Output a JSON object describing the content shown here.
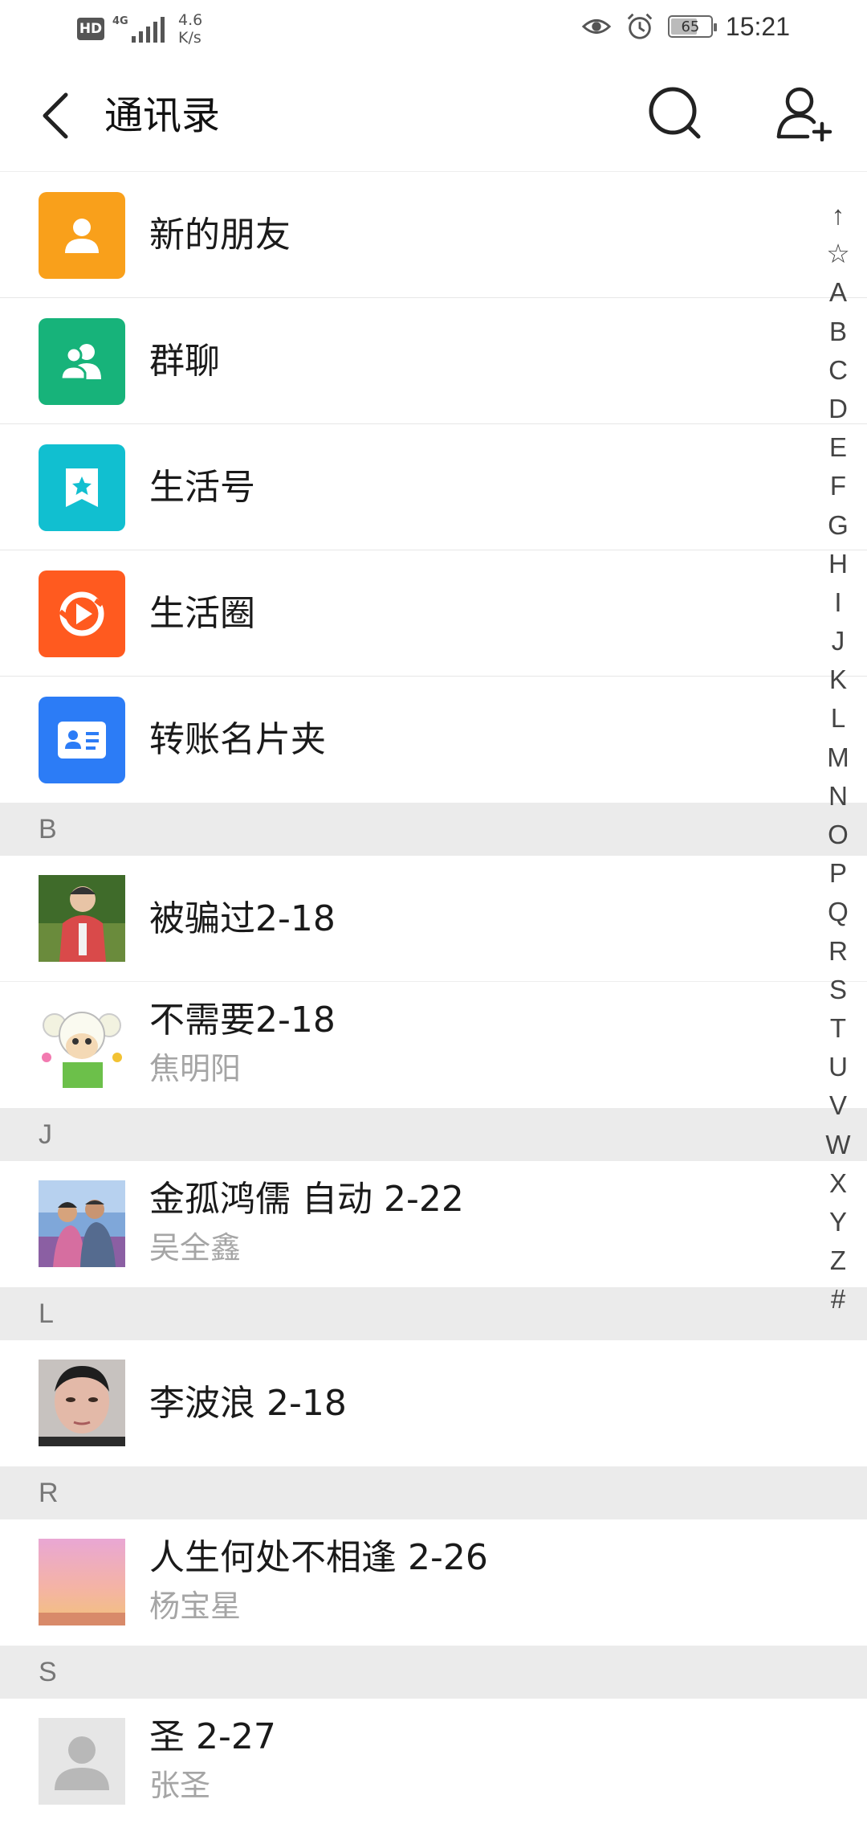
{
  "status_bar": {
    "hd": "HD",
    "network": "4G",
    "speed_value": "4.6",
    "speed_unit": "K/s",
    "battery": "65",
    "time": "15:21"
  },
  "header": {
    "title": "通讯录"
  },
  "menu": [
    {
      "label": "新的朋友",
      "icon": "new-friend-icon",
      "color": "#F9A01B"
    },
    {
      "label": "群聊",
      "icon": "group-chat-icon",
      "color": "#17B37A"
    },
    {
      "label": "生活号",
      "icon": "life-account-icon",
      "color": "#11BFD0"
    },
    {
      "label": "生活圈",
      "icon": "life-circle-icon",
      "color": "#FF5A1F"
    },
    {
      "label": "转账名片夹",
      "icon": "card-holder-icon",
      "color": "#2C7CF6"
    }
  ],
  "sections": [
    {
      "letter": "B",
      "contacts": [
        {
          "name": "被骗过2-18",
          "sub": ""
        },
        {
          "name": "不需要2-18",
          "sub": "焦明阳"
        }
      ]
    },
    {
      "letter": "J",
      "contacts": [
        {
          "name": "金孤鸿儒 自动 2-22",
          "sub": "吴全鑫"
        }
      ]
    },
    {
      "letter": "L",
      "contacts": [
        {
          "name": "李波浪 2-18",
          "sub": ""
        }
      ]
    },
    {
      "letter": "R",
      "contacts": [
        {
          "name": "人生何处不相逢 2-26",
          "sub": "杨宝星"
        }
      ]
    },
    {
      "letter": "S",
      "contacts": [
        {
          "name": "圣 2-27",
          "sub": "张圣"
        }
      ]
    }
  ],
  "index_bar": [
    "↑",
    "☆",
    "A",
    "B",
    "C",
    "D",
    "E",
    "F",
    "G",
    "H",
    "I",
    "J",
    "K",
    "L",
    "M",
    "N",
    "O",
    "P",
    "Q",
    "R",
    "S",
    "T",
    "U",
    "V",
    "W",
    "X",
    "Y",
    "Z",
    "#"
  ]
}
